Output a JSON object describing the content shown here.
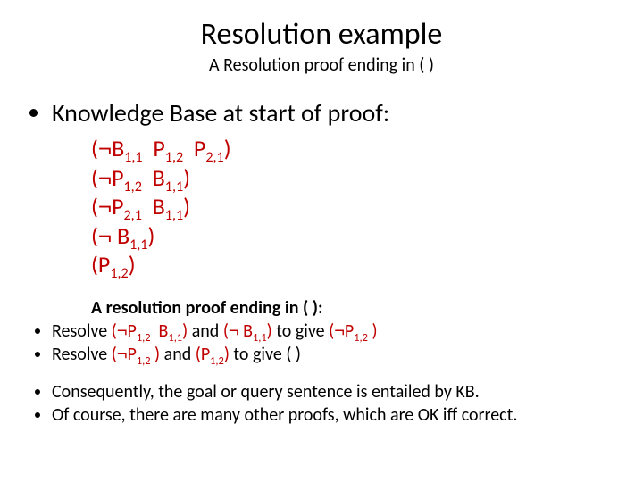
{
  "title": "Resolution example",
  "subtitle": "A Resolution proof ending in ( )",
  "bullets": {
    "kb_heading": "Knowledge Base at start of proof:",
    "proof_heading": "A resolution proof ending in ( ):",
    "resolve1_pre": "Resolve ",
    "resolve1_mid": " and ",
    "resolve1_post": " to give ",
    "resolve2_pre": "Resolve ",
    "resolve2_mid": " and ",
    "resolve2_post": " to give ",
    "empty_clause": "( )",
    "concl1": "Consequently, the goal or query sentence is entailed by KB.",
    "concl2": "Of course, there are many other proofs, which are OK iff correct."
  },
  "symbols": {
    "neg": "¬",
    "B": "B",
    "P": "P",
    "s11": "1,1",
    "s12": "1,2",
    "s21": "2,1"
  },
  "clauses_text": {
    "c1": "(¬B1,1  P1,2  P2,1)",
    "c2": "(¬P1,2  B1,1)",
    "c3": "(¬P2,1  B1,1)",
    "c4": "(¬ B1,1)",
    "c5": "(P1,2)",
    "r1a": "(¬P1,2  B1,1)",
    "r1b": "(¬ B1,1)",
    "r1c": "(¬P1,2 )",
    "r2a": "(¬P1,2 )",
    "r2b": "(P1,2)"
  }
}
